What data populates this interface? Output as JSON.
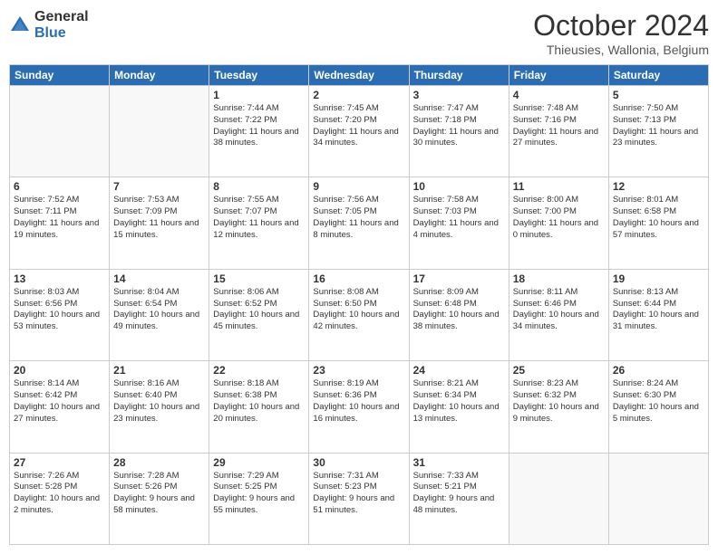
{
  "logo": {
    "general": "General",
    "blue": "Blue"
  },
  "header": {
    "month_year": "October 2024",
    "location": "Thieusies, Wallonia, Belgium"
  },
  "weekdays": [
    "Sunday",
    "Monday",
    "Tuesday",
    "Wednesday",
    "Thursday",
    "Friday",
    "Saturday"
  ],
  "weeks": [
    [
      {
        "day": "",
        "info": ""
      },
      {
        "day": "",
        "info": ""
      },
      {
        "day": "1",
        "info": "Sunrise: 7:44 AM\nSunset: 7:22 PM\nDaylight: 11 hours and 38 minutes."
      },
      {
        "day": "2",
        "info": "Sunrise: 7:45 AM\nSunset: 7:20 PM\nDaylight: 11 hours and 34 minutes."
      },
      {
        "day": "3",
        "info": "Sunrise: 7:47 AM\nSunset: 7:18 PM\nDaylight: 11 hours and 30 minutes."
      },
      {
        "day": "4",
        "info": "Sunrise: 7:48 AM\nSunset: 7:16 PM\nDaylight: 11 hours and 27 minutes."
      },
      {
        "day": "5",
        "info": "Sunrise: 7:50 AM\nSunset: 7:13 PM\nDaylight: 11 hours and 23 minutes."
      }
    ],
    [
      {
        "day": "6",
        "info": "Sunrise: 7:52 AM\nSunset: 7:11 PM\nDaylight: 11 hours and 19 minutes."
      },
      {
        "day": "7",
        "info": "Sunrise: 7:53 AM\nSunset: 7:09 PM\nDaylight: 11 hours and 15 minutes."
      },
      {
        "day": "8",
        "info": "Sunrise: 7:55 AM\nSunset: 7:07 PM\nDaylight: 11 hours and 12 minutes."
      },
      {
        "day": "9",
        "info": "Sunrise: 7:56 AM\nSunset: 7:05 PM\nDaylight: 11 hours and 8 minutes."
      },
      {
        "day": "10",
        "info": "Sunrise: 7:58 AM\nSunset: 7:03 PM\nDaylight: 11 hours and 4 minutes."
      },
      {
        "day": "11",
        "info": "Sunrise: 8:00 AM\nSunset: 7:00 PM\nDaylight: 11 hours and 0 minutes."
      },
      {
        "day": "12",
        "info": "Sunrise: 8:01 AM\nSunset: 6:58 PM\nDaylight: 10 hours and 57 minutes."
      }
    ],
    [
      {
        "day": "13",
        "info": "Sunrise: 8:03 AM\nSunset: 6:56 PM\nDaylight: 10 hours and 53 minutes."
      },
      {
        "day": "14",
        "info": "Sunrise: 8:04 AM\nSunset: 6:54 PM\nDaylight: 10 hours and 49 minutes."
      },
      {
        "day": "15",
        "info": "Sunrise: 8:06 AM\nSunset: 6:52 PM\nDaylight: 10 hours and 45 minutes."
      },
      {
        "day": "16",
        "info": "Sunrise: 8:08 AM\nSunset: 6:50 PM\nDaylight: 10 hours and 42 minutes."
      },
      {
        "day": "17",
        "info": "Sunrise: 8:09 AM\nSunset: 6:48 PM\nDaylight: 10 hours and 38 minutes."
      },
      {
        "day": "18",
        "info": "Sunrise: 8:11 AM\nSunset: 6:46 PM\nDaylight: 10 hours and 34 minutes."
      },
      {
        "day": "19",
        "info": "Sunrise: 8:13 AM\nSunset: 6:44 PM\nDaylight: 10 hours and 31 minutes."
      }
    ],
    [
      {
        "day": "20",
        "info": "Sunrise: 8:14 AM\nSunset: 6:42 PM\nDaylight: 10 hours and 27 minutes."
      },
      {
        "day": "21",
        "info": "Sunrise: 8:16 AM\nSunset: 6:40 PM\nDaylight: 10 hours and 23 minutes."
      },
      {
        "day": "22",
        "info": "Sunrise: 8:18 AM\nSunset: 6:38 PM\nDaylight: 10 hours and 20 minutes."
      },
      {
        "day": "23",
        "info": "Sunrise: 8:19 AM\nSunset: 6:36 PM\nDaylight: 10 hours and 16 minutes."
      },
      {
        "day": "24",
        "info": "Sunrise: 8:21 AM\nSunset: 6:34 PM\nDaylight: 10 hours and 13 minutes."
      },
      {
        "day": "25",
        "info": "Sunrise: 8:23 AM\nSunset: 6:32 PM\nDaylight: 10 hours and 9 minutes."
      },
      {
        "day": "26",
        "info": "Sunrise: 8:24 AM\nSunset: 6:30 PM\nDaylight: 10 hours and 5 minutes."
      }
    ],
    [
      {
        "day": "27",
        "info": "Sunrise: 7:26 AM\nSunset: 5:28 PM\nDaylight: 10 hours and 2 minutes."
      },
      {
        "day": "28",
        "info": "Sunrise: 7:28 AM\nSunset: 5:26 PM\nDaylight: 9 hours and 58 minutes."
      },
      {
        "day": "29",
        "info": "Sunrise: 7:29 AM\nSunset: 5:25 PM\nDaylight: 9 hours and 55 minutes."
      },
      {
        "day": "30",
        "info": "Sunrise: 7:31 AM\nSunset: 5:23 PM\nDaylight: 9 hours and 51 minutes."
      },
      {
        "day": "31",
        "info": "Sunrise: 7:33 AM\nSunset: 5:21 PM\nDaylight: 9 hours and 48 minutes."
      },
      {
        "day": "",
        "info": ""
      },
      {
        "day": "",
        "info": ""
      }
    ]
  ]
}
